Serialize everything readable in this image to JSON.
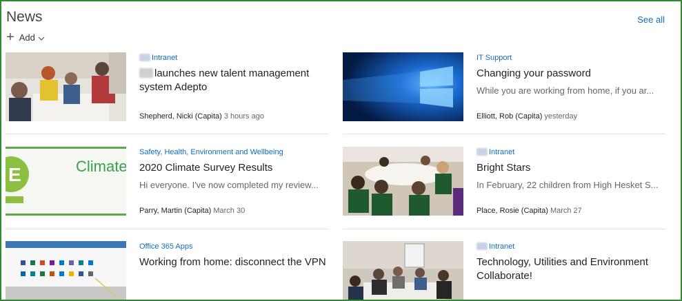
{
  "header": {
    "title": "News",
    "see_all": "See all",
    "add_label": "Add"
  },
  "cards": [
    {
      "category": "Intranet",
      "headline": "launches new talent management system Adepto",
      "description": "",
      "author": "Shepherd, Nicki (Capita)",
      "time": "3 hours ago"
    },
    {
      "category": "IT Support",
      "headline": "Changing your password",
      "description": "While you are working from home, if you ar...",
      "author": "Elliott, Rob (Capita)",
      "time": "yesterday"
    },
    {
      "category": "Safety, Health, Environment and Wellbeing",
      "headline": "2020 Climate Survey Results",
      "description": "Hi everyone. I've now completed my review...",
      "author": "Parry, Martin (Capita)",
      "time": "March 30"
    },
    {
      "category": "Intranet",
      "headline": "Bright Stars",
      "description": "In February,  22 children from High Hesket S...",
      "author": "Place, Rosie (Capita)",
      "time": "March 27"
    },
    {
      "category": "Office 365 Apps",
      "headline": "Working from home: disconnect the VPN",
      "description": "",
      "author": "",
      "time": ""
    },
    {
      "category": "Intranet",
      "headline": "Technology, Utilities and Environment Collaborate!",
      "description": "",
      "author": "",
      "time": ""
    }
  ],
  "thumbs": {
    "climate_text": "Climate",
    "climate_letter": "E"
  },
  "colors": {
    "link": "#0f6cbd",
    "frame": "#2e8b2e"
  }
}
